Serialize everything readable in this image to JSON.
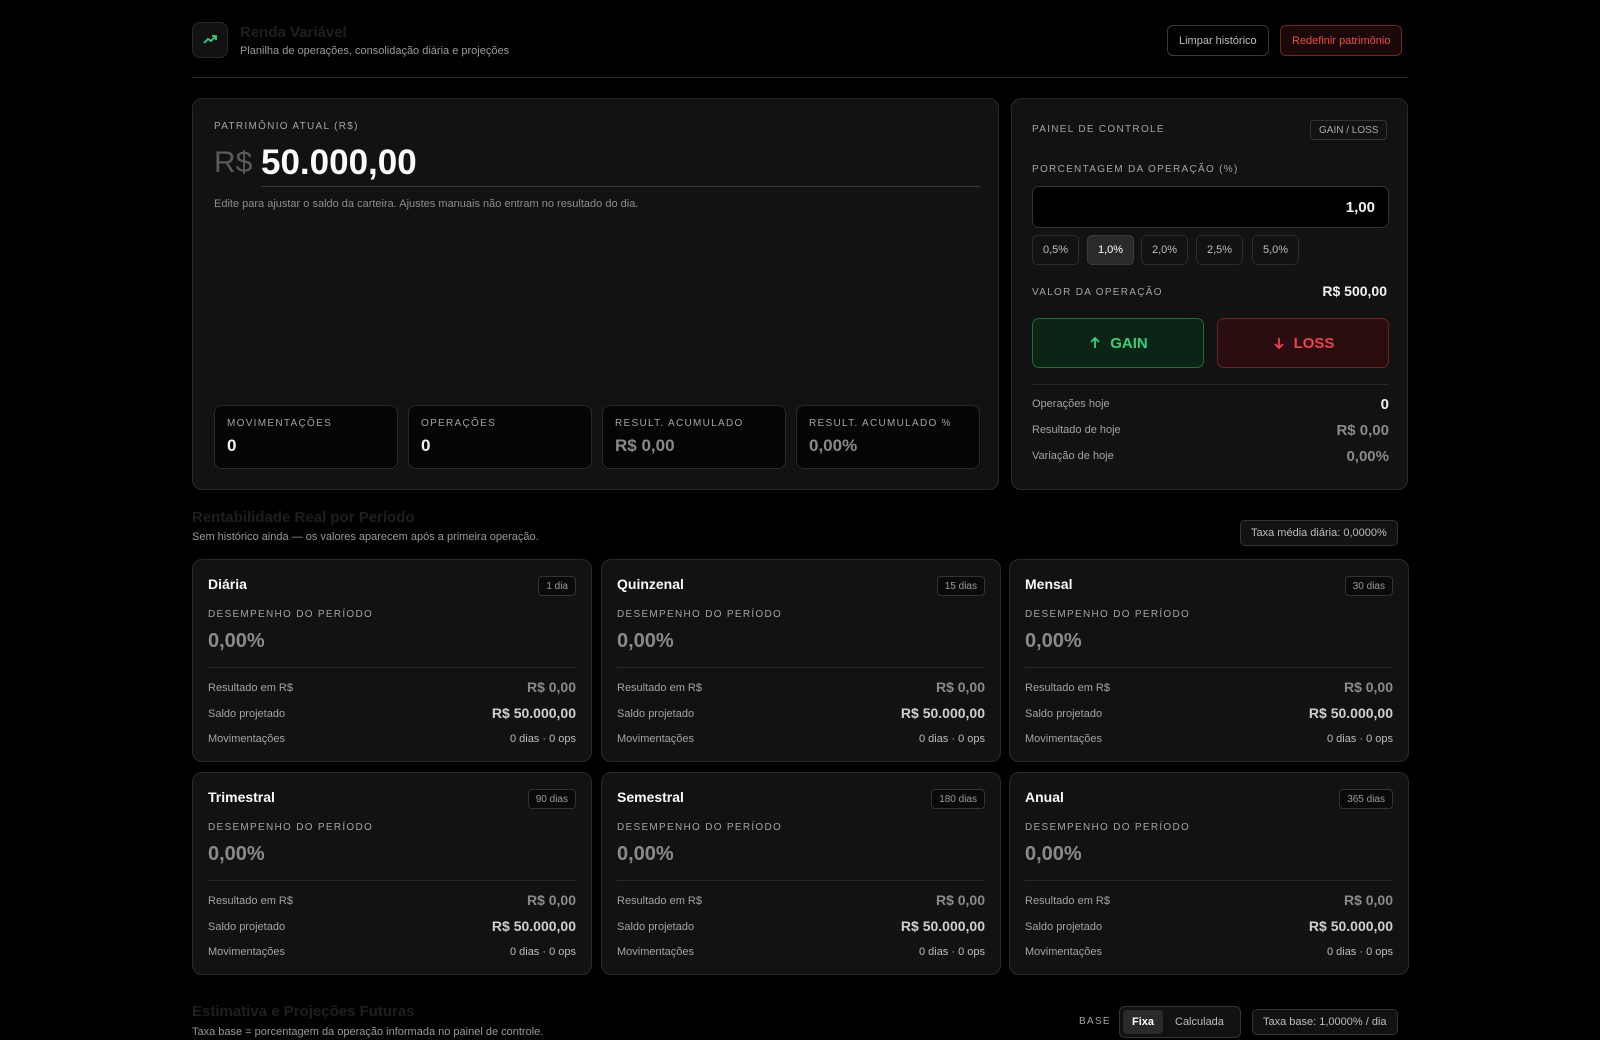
{
  "header": {
    "title": "Renda Variável",
    "subtitle": "Planilha de operações, consolidação diária e projeções",
    "clear_label": "Limpar histórico",
    "reset_label": "Redefinir patrimônio"
  },
  "balance": {
    "label": "PATRIMÔNIO ATUAL (R$)",
    "currency": "R$",
    "value": "50.000,00",
    "help": "Edite para ajustar o saldo da carteira. Ajustes manuais não entram no resultado do dia."
  },
  "stats": [
    {
      "label": "MOVIMENTAÇÕES",
      "value": "0"
    },
    {
      "label": "OPERAÇÕES",
      "value": "0"
    },
    {
      "label": "RESULT. ACUMULADO",
      "value": "R$ 0,00"
    },
    {
      "label": "RESULT. ACUMULADO %",
      "value": "0,00%"
    }
  ],
  "control": {
    "title": "PAINEL DE CONTROLE",
    "badge": "GAIN / LOSS",
    "pct_label": "PORCENTAGEM DA OPERAÇÃO (%)",
    "pct_value": "1,00",
    "chips": [
      "0,5%",
      "1,0%",
      "2,0%",
      "2,5%",
      "5,0%"
    ],
    "active_chip": "1,0%",
    "op_label": "VALOR DA OPERAÇÃO",
    "op_value": "R$ 500,00",
    "gain_label": "GAIN",
    "loss_label": "LOSS",
    "today": [
      {
        "label": "Operações hoje",
        "value": "0"
      },
      {
        "label": "Resultado de hoje",
        "value": "R$ 0,00"
      },
      {
        "label": "Variação de hoje",
        "value": "0,00%"
      }
    ]
  },
  "periods_section": {
    "title": "Rentabilidade Real por Período",
    "subtitle": "Sem histórico ainda — os valores aparecem após a primeira operação.",
    "rate_pill": "Taxa média diária: 0,0000%"
  },
  "period_labels": {
    "perf": "DESEMPENHO DO PERÍODO",
    "result": "Resultado em R$",
    "projected": "Saldo projetado",
    "moves": "Movimentações"
  },
  "periods": [
    {
      "name": "Diária",
      "days": "1 dia",
      "perf": "0,00%",
      "result": "R$ 0,00",
      "projected": "R$ 50.000,00",
      "moves": "0 dias · 0 ops"
    },
    {
      "name": "Quinzenal",
      "days": "15 dias",
      "perf": "0,00%",
      "result": "R$ 0,00",
      "projected": "R$ 50.000,00",
      "moves": "0 dias · 0 ops"
    },
    {
      "name": "Mensal",
      "days": "30 dias",
      "perf": "0,00%",
      "result": "R$ 0,00",
      "projected": "R$ 50.000,00",
      "moves": "0 dias · 0 ops"
    },
    {
      "name": "Trimestral",
      "days": "90 dias",
      "perf": "0,00%",
      "result": "R$ 0,00",
      "projected": "R$ 50.000,00",
      "moves": "0 dias · 0 ops"
    },
    {
      "name": "Semestral",
      "days": "180 dias",
      "perf": "0,00%",
      "result": "R$ 0,00",
      "projected": "R$ 50.000,00",
      "moves": "0 dias · 0 ops"
    },
    {
      "name": "Anual",
      "days": "365 dias",
      "perf": "0,00%",
      "result": "R$ 0,00",
      "projected": "R$ 50.000,00",
      "moves": "0 dias · 0 ops"
    }
  ],
  "projection_section": {
    "title": "Estimativa e Projeções Futuras",
    "subtitle": "Taxa base = porcentagem da operação informada no painel de controle.",
    "base_label": "BASE",
    "toggle": [
      "Fixa",
      "Calculada"
    ],
    "rate_pill": "Taxa base: 1,0000% / dia"
  }
}
